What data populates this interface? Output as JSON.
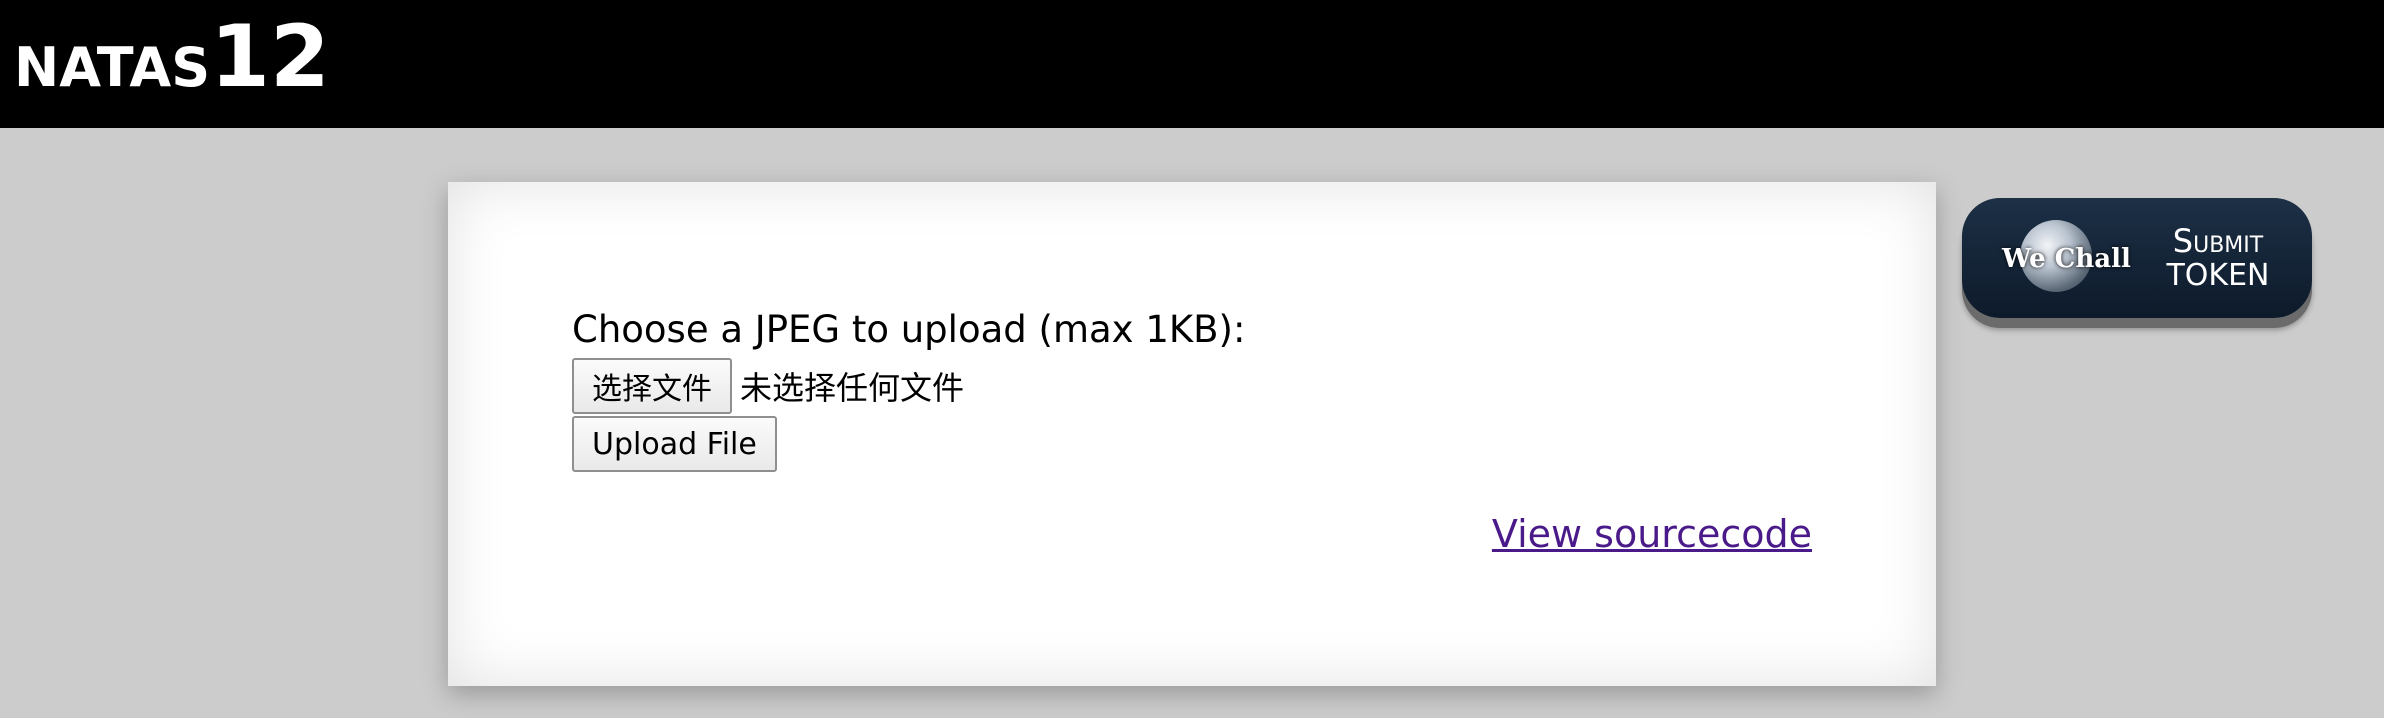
{
  "header": {
    "title_prefix": "NATAS",
    "title_level": "12"
  },
  "form": {
    "prompt": "Choose a JPEG to upload (max 1KB):",
    "choose_file_label": "选择文件",
    "no_file_text": "未选择任何文件",
    "upload_label": "Upload File"
  },
  "links": {
    "view_source": "View sourcecode"
  },
  "wechall": {
    "logo_text": "We Chall",
    "line1": "Submit",
    "line2": "token"
  },
  "colors": {
    "header_bg": "#000000",
    "page_bg": "#cccccc",
    "link": "#4b1a8a",
    "badge_bg": "#13263a"
  }
}
